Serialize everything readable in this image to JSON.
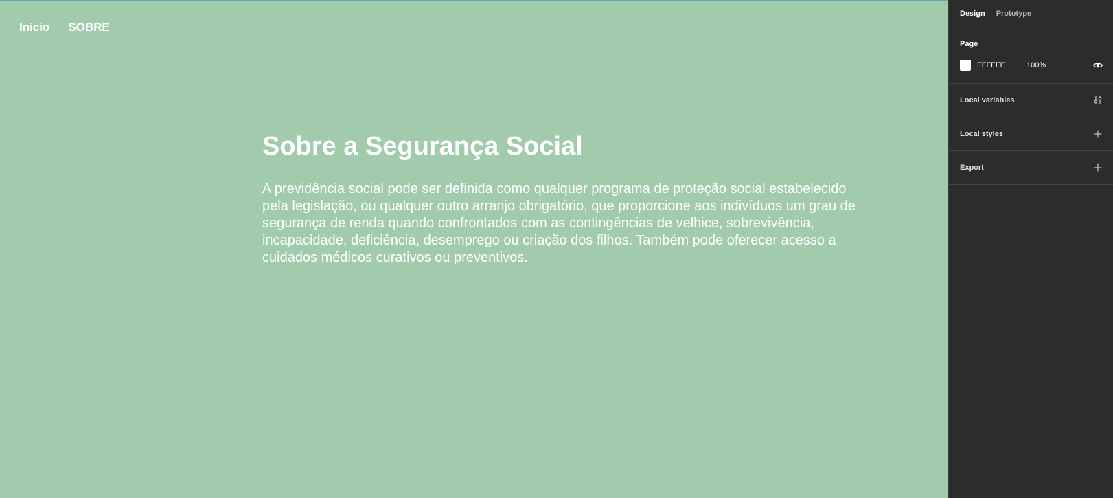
{
  "canvas": {
    "background": "#a2cbad",
    "nav": {
      "links": [
        "Inicio",
        "SOBRE"
      ]
    },
    "heading": "Sobre a Segurança Social",
    "paragraph": "A previdência social pode ser definida como qualquer programa de proteção social estabelecido pela legislação, ou qualquer outro arranjo obrigatório, que proporcione aos indivíduos um grau de segurança de renda quando confrontados com as contingências de velhice, sobrevivência, incapacidade, deficiência, desemprego ou criação dos filhos. Também pode oferecer acesso a cuidados médicos curativos ou preventivos."
  },
  "panel": {
    "tabs": [
      "Design",
      "Prototype"
    ],
    "active_tab": "Design",
    "page": {
      "title": "Page",
      "color_hex": "FFFFFF",
      "opacity": "100%",
      "visibility_icon": "eye-icon"
    },
    "sections": [
      {
        "label": "Local variables",
        "icon": "sliders-icon"
      },
      {
        "label": "Local styles",
        "icon": "plus-icon"
      },
      {
        "label": "Export",
        "icon": "plus-icon"
      }
    ]
  },
  "colors": {
    "canvas_bg": "#a2cbad",
    "panel_bg": "#2c2c2c",
    "text_white": "#ffffff"
  }
}
